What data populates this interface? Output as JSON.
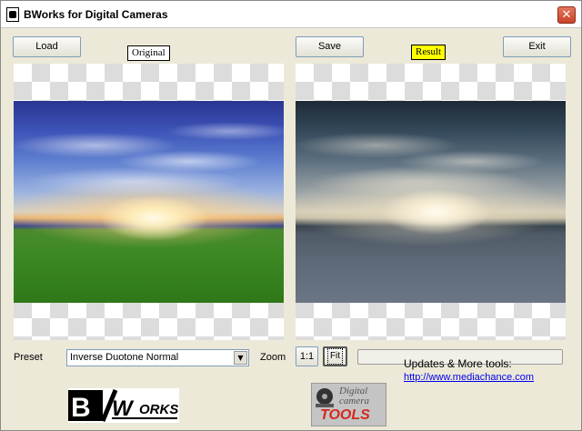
{
  "window": {
    "title": "BWorks for Digital Cameras",
    "close_glyph": "✕"
  },
  "toolbar": {
    "load_label": "Load",
    "save_label": "Save",
    "exit_label": "Exit"
  },
  "panels": {
    "original_tag": "Original",
    "result_tag": "Result"
  },
  "controls": {
    "preset_label": "Preset",
    "preset_value": "Inverse Duotone Normal",
    "zoom_label": "Zoom",
    "zoom_1to1_label": "1:1",
    "zoom_fit_label": "Fit"
  },
  "logos": {
    "bworks": "BWorks",
    "dct_line1": "Digital",
    "dct_line2": "camera",
    "dct_tools": "TOOLS"
  },
  "footer": {
    "updates_text": "Updates & More tools:",
    "link_text": "http://www.mediachance.com"
  },
  "colors": {
    "result_tag_bg": "#ffff00",
    "original_tag_bg": "#ffffff",
    "link": "#0000ee",
    "tools_red": "#d42a1e"
  },
  "icons": {
    "close": "close-icon",
    "select_arrow": "chevron-down-icon",
    "app": "app-icon"
  }
}
